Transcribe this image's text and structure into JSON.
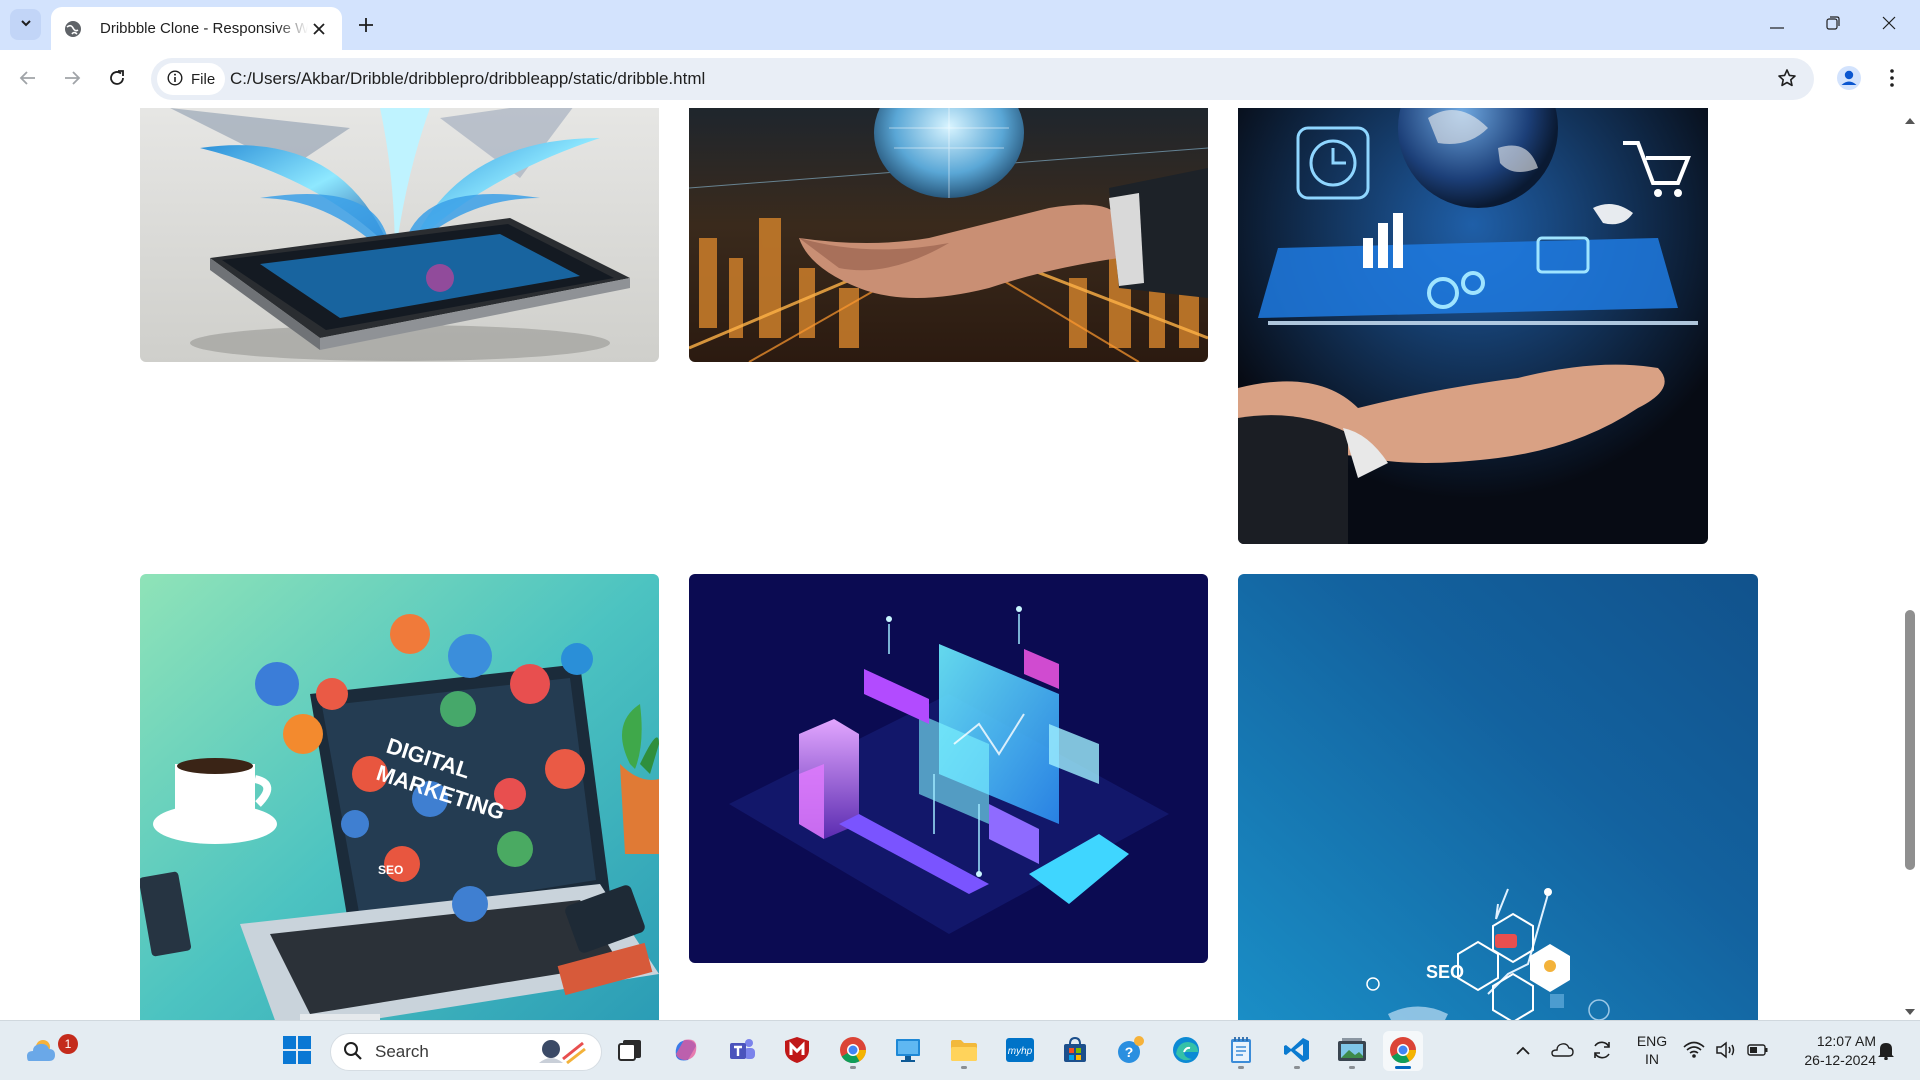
{
  "browser": {
    "tab_title": "Dribbble Clone - Responsive Website",
    "site_chip_label": "File",
    "url": "C:/Users/Akbar/Dribble/dribblepro/dribbleapp/static/dribble.html",
    "icons": [
      "tab-search-icon",
      "globe-icon",
      "close-icon",
      "plus-icon",
      "minimize-icon",
      "restore-icon",
      "back-icon",
      "forward-icon",
      "reload-icon",
      "info-icon",
      "star-icon",
      "profile-icon",
      "kebab-menu-icon"
    ]
  },
  "gallery": {
    "cards": [
      {
        "id": "card-1",
        "subject": "smartphone with holographic splash"
      },
      {
        "id": "card-2",
        "subject": "hand holding glowing globe over city"
      },
      {
        "id": "card-3",
        "subject": "hand below floating business icons and globe"
      },
      {
        "id": "card-4",
        "subject": "digital marketing laptop illustration",
        "text": {
          "line1": "DIGITAL",
          "line2": "MARKETING",
          "badge": "SEO"
        }
      },
      {
        "id": "card-5",
        "subject": "isometric neon data dashboard"
      },
      {
        "id": "card-6",
        "subject": "blue background with SEO hexagon network",
        "text": {
          "badge": "SEO"
        }
      }
    ]
  },
  "taskbar": {
    "search_placeholder": "Search",
    "weather_badge": "1",
    "pinned": [
      "windows-start",
      "search",
      "task-view",
      "copilot",
      "teams",
      "mcafee",
      "chrome",
      "remote-desktop",
      "file-explorer",
      "myhp",
      "microsoft-store",
      "support",
      "edge",
      "notepad",
      "vscode",
      "gallery-app",
      "chrome-active"
    ],
    "language": {
      "line1": "ENG",
      "line2": "IN"
    },
    "time": "12:07 AM",
    "date": "26-12-2024",
    "colors": {
      "accent": "#0067c0",
      "taskbar_bg": "#e4ecf2",
      "tabstrip_bg": "#d3e3fd"
    }
  }
}
